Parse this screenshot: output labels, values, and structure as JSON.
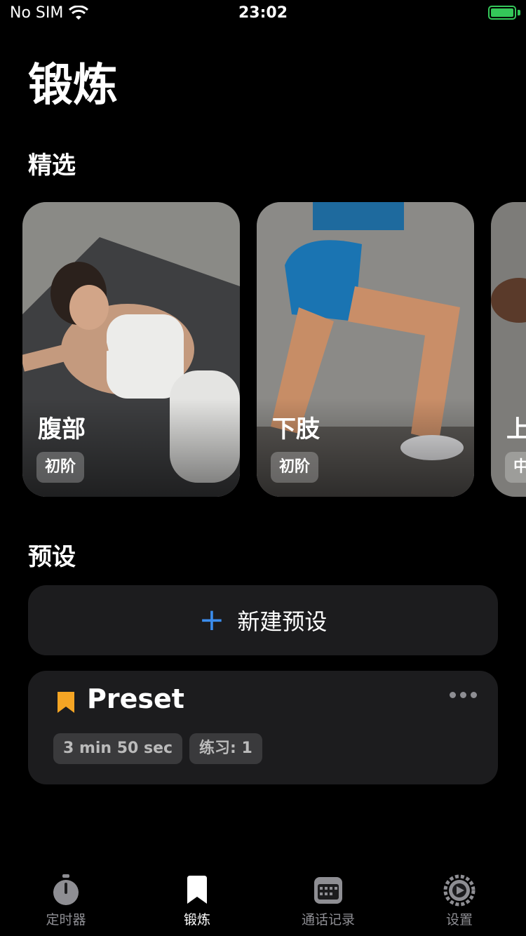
{
  "status": {
    "carrier": "No SIM",
    "time": "23:02",
    "battery_color": "#34c759"
  },
  "title": "锻炼",
  "featured": {
    "heading": "精选",
    "cards": [
      {
        "label": "腹部",
        "level": "初阶"
      },
      {
        "label": "下肢",
        "level": "初阶"
      },
      {
        "label": "上",
        "level": "中"
      }
    ]
  },
  "presets": {
    "heading": "预设",
    "new_label": "新建预设",
    "accent": "#3b8ded",
    "items": [
      {
        "title": "Preset",
        "duration": "3 min 50 sec",
        "exercises": "练习: 1",
        "bookmark_color": "#f5a524"
      }
    ]
  },
  "tabs": [
    {
      "label": "定时器",
      "icon": "stopwatch-icon"
    },
    {
      "label": "锻炼",
      "icon": "bookmark-icon",
      "active": true
    },
    {
      "label": "通话记录",
      "icon": "calendar-icon"
    },
    {
      "label": "设置",
      "icon": "gear-icon"
    }
  ]
}
